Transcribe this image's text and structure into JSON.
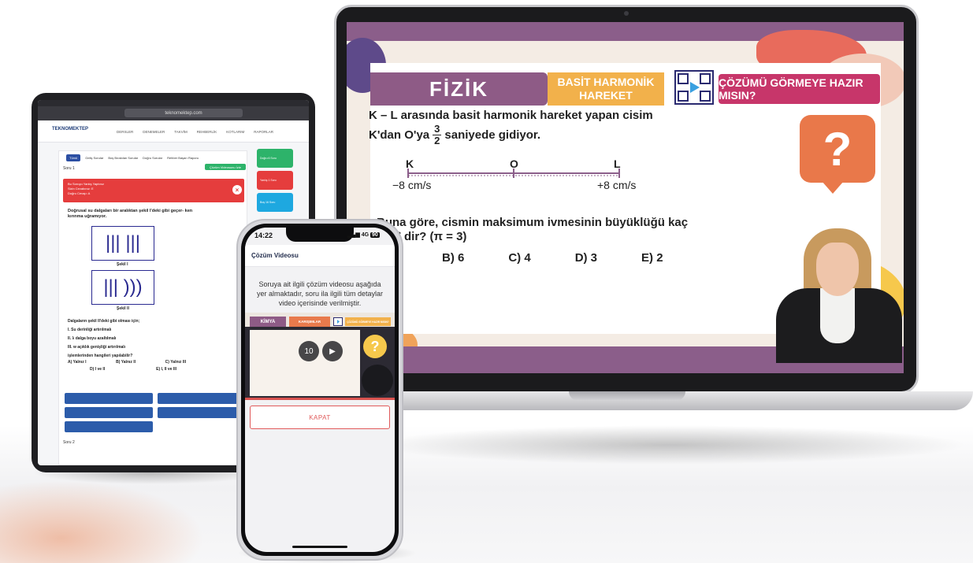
{
  "laptop": {
    "subject": "FİZİK",
    "topic": "BASİT HARMONİK HAREKET",
    "cta": "ÇÖZÜMÜ GÖRMEYE HAZIR MISIN?",
    "question_line1": "K – L arasında basit harmonik hareket yapan cisim",
    "question_line2_a": "K'dan O'ya",
    "frac_num": "3",
    "frac_den": "2",
    "question_line2_b": "saniyede gidiyor.",
    "point_k": "K",
    "point_o": "O",
    "point_l": "L",
    "speed_left": "−8 cm/s",
    "speed_right": "+8 cm/s",
    "question_line3": "Buna göre, cismin maksimum ivmesinin büyüklüğü kaç",
    "question_line4": "m/s² dir? (π = 3)",
    "options": [
      "B) 6",
      "C) 4",
      "D) 3",
      "E) 2"
    ],
    "question_mark": "?"
  },
  "tablet": {
    "url": "teknomektep.com",
    "logo": "TEKNOMEKTEP",
    "nav": [
      "DERSLER",
      "DENEMELER",
      "TAKVİM",
      "REHBERLİK",
      "KOTLARIM",
      "RAPORLAR"
    ],
    "filters": [
      "Tümü",
      "Geliş Sorular",
      "Boş Bırakılan Sorular",
      "Doğru Sorular",
      "Rehber Başarı Raporu"
    ],
    "solution_button": "Çözüm Videosunu İzle",
    "question_number": "Soru 1",
    "alert_title": "Bu Soruyu Yanlış Yaptınız",
    "alert_line2": "Sizin Cevabınız: E",
    "alert_line3": "Doğru Cevap: A",
    "question_text": "Doğrusal su dalgaları bir aralıktan şekil I'deki gibi geçer- ken kırınma uğramıyor.",
    "figure1_label": "Şekil I",
    "figure2_label": "Şekil II",
    "list_header": "Dalgaların şekil II'deki gibi olması için;",
    "list": [
      "I. Su derinliği artırılmalı",
      "II. λ dalga boyu azaltılmalı",
      "III. w açıklık genişliği artırılmalı"
    ],
    "list_footer": "işlemlerinden hangileri yapılabilir?",
    "options_row1": [
      "A) Yalnız I",
      "B) Yalnız II",
      "C) Yalnız III"
    ],
    "options_row2": [
      "D) I ve II",
      "E) I, II ve III"
    ],
    "side_cards": [
      "Doğru 6 Soru",
      "Yanlış 1 Soru",
      "Boş 16 Soru"
    ],
    "question_number_2": "Soru 2"
  },
  "phone": {
    "time": "14:22",
    "network": "4G",
    "battery": "90",
    "title": "Çözüm Videosu",
    "description": "Soruya ait ilgili çözüm videosu aşağıda yer almaktadır, soru ila ilgili tüm detaylar video içerisinde verilmiştir.",
    "video_subject": "KİMYA",
    "video_topic": "KARIŞIMLAR",
    "video_cta": "ÇÖZÜMÜ GÖRMEYE HAZIR MISIN?",
    "replay_label": "10",
    "close_button": "KAPAT",
    "question_mark": "?"
  }
}
